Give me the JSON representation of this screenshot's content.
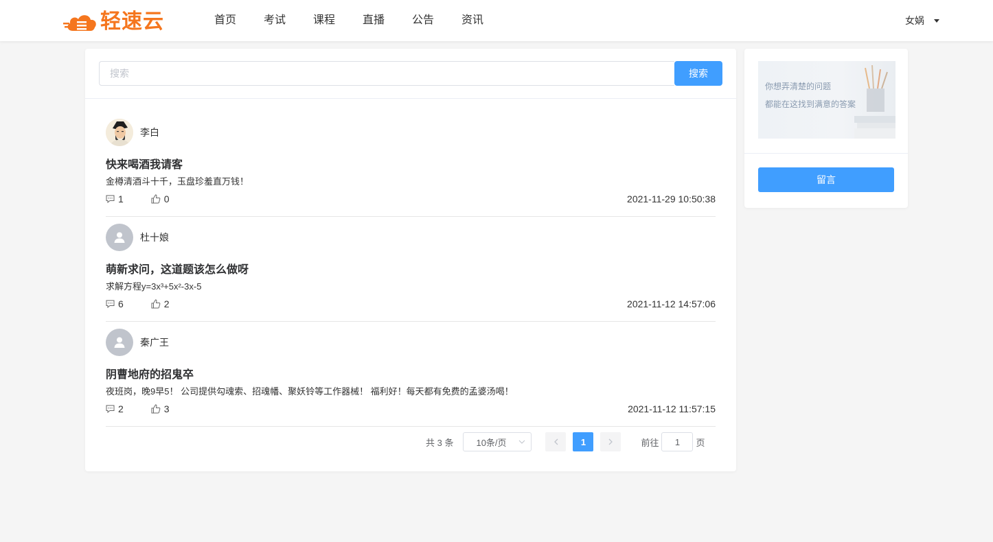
{
  "header": {
    "logo_text": "轻速云",
    "brand_color": "#f5761e",
    "nav": [
      {
        "label": "首页"
      },
      {
        "label": "考试"
      },
      {
        "label": "课程"
      },
      {
        "label": "直播"
      },
      {
        "label": "公告"
      },
      {
        "label": "资讯"
      }
    ],
    "user_name": "女娲"
  },
  "search": {
    "placeholder": "搜索",
    "button_label": "搜索"
  },
  "posts": [
    {
      "author": "李白",
      "avatar": "portrait-avatar",
      "title": "快来喝酒我请客",
      "content": "金樽清酒斗十千，玉盘珍羞直万钱！",
      "comments": "1",
      "likes": "0",
      "time": "2021-11-29 10:50:38"
    },
    {
      "author": "杜十娘",
      "avatar": "default-user-avatar",
      "title": "萌新求问，这道题该怎么做呀",
      "content": "求解方程y=3x³+5x²-3x-5",
      "comments": "6",
      "likes": "2",
      "time": "2021-11-12 14:57:06"
    },
    {
      "author": "秦广王",
      "avatar": "default-user-avatar",
      "title": "阴曹地府的招鬼卒",
      "content": "夜班岗，晚9早5！ 公司提供勾魂索、招魂幡、聚妖铃等工作器械！ 福利好！每天都有免费的孟婆汤喝！",
      "comments": "2",
      "likes": "3",
      "time": "2021-11-12 11:57:15"
    }
  ],
  "pagination": {
    "total_text": "共 3 条",
    "page_size": "10条/页",
    "current_page": "1",
    "goto_label": "前往",
    "goto_value": "1",
    "page_unit": "页"
  },
  "sidebar": {
    "banner_line1": "你想弄清楚的问题",
    "banner_line2": "都能在这找到满意的答案",
    "message_button": "留言"
  },
  "colors": {
    "primary": "#409eff",
    "background": "#f5f5f5"
  }
}
